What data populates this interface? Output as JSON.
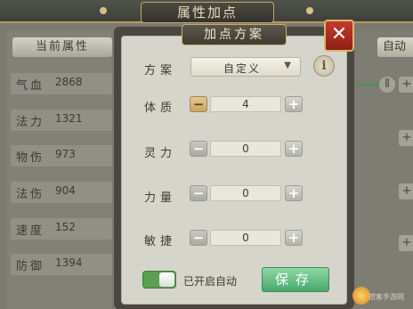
{
  "window": {
    "title": "属性加点"
  },
  "left_panel": {
    "header": "当前属性",
    "stats": [
      {
        "name": "气血",
        "value": "2868"
      },
      {
        "name": "法力",
        "value": "1321"
      },
      {
        "name": "物伤",
        "value": "973"
      },
      {
        "name": "法伤",
        "value": "904"
      },
      {
        "name": "速度",
        "value": "152"
      },
      {
        "name": "防御",
        "value": "1394"
      }
    ]
  },
  "right_panel": {
    "auto_label": "自动"
  },
  "dialog": {
    "title": "加点方案",
    "close_symbol": "✕",
    "scheme": {
      "label": "方案",
      "value": "自定义",
      "arrow": "▼",
      "info_symbol": "i"
    },
    "attributes": [
      {
        "label": "体质",
        "value": "4"
      },
      {
        "label": "灵力",
        "value": "0"
      },
      {
        "label": "力量",
        "value": "0"
      },
      {
        "label": "敏捷",
        "value": "0"
      }
    ],
    "minus_symbol": "−",
    "plus_symbol": "+",
    "auto_toggle": {
      "label": "已开启自动",
      "on": true
    },
    "save_label": "保存"
  },
  "colors": {
    "accent_gold": "#c9ad70",
    "close_red": "#c33b2a",
    "save_green": "#46a86c",
    "toggle_green": "#5aa04d"
  },
  "watermark": {
    "text": "捞客手游网"
  }
}
